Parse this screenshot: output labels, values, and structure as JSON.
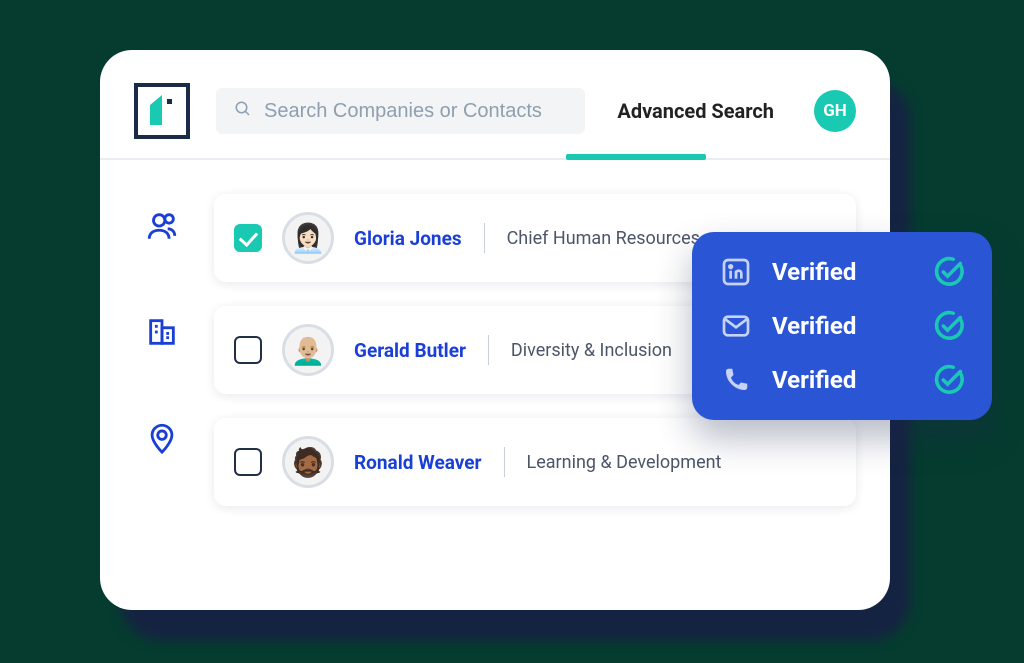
{
  "colors": {
    "accent": "#1ac9b2",
    "link": "#1a3fd6",
    "popup_bg": "#2a56d6",
    "page_bg": "#053c2f"
  },
  "header": {
    "search_placeholder": "Search Companies or Contacts",
    "advanced_label": "Advanced Search",
    "avatar_initials": "GH"
  },
  "sidebar": {
    "items": [
      {
        "icon": "people-icon"
      },
      {
        "icon": "building-icon"
      },
      {
        "icon": "location-icon"
      }
    ]
  },
  "contacts": [
    {
      "checked": true,
      "avatar_emoji": "👩🏻‍💼",
      "name": "Gloria Jones",
      "title": "Chief Human Resources"
    },
    {
      "checked": false,
      "avatar_emoji": "👨🏼‍🦲",
      "name": "Gerald Butler",
      "title": "Diversity & Inclusion"
    },
    {
      "checked": false,
      "avatar_emoji": "🧔🏾",
      "name": "Ronald Weaver",
      "title": "Learning & Development"
    }
  ],
  "verified_popup": {
    "items": [
      {
        "icon": "linkedin-icon",
        "label": "Verified"
      },
      {
        "icon": "mail-icon",
        "label": "Verified"
      },
      {
        "icon": "phone-icon",
        "label": "Verified"
      }
    ]
  }
}
